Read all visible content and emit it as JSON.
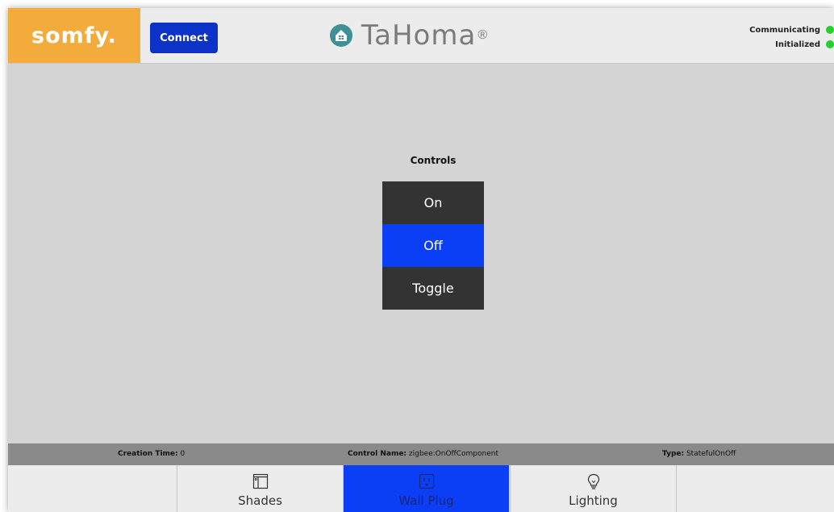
{
  "header": {
    "logo_text": "somfy.",
    "connect_label": "Connect",
    "brand_name": "TaHoma",
    "brand_mark": "®",
    "status": [
      {
        "label": "Communicating",
        "color": "#22d12b"
      },
      {
        "label": "Initialized",
        "color": "#22d12b"
      }
    ]
  },
  "controls": {
    "title": "Controls",
    "buttons": [
      {
        "label": "On",
        "active": false
      },
      {
        "label": "Off",
        "active": true
      },
      {
        "label": "Toggle",
        "active": false
      }
    ]
  },
  "info_bar": {
    "creation_label": "Creation Time:",
    "creation_value": "0",
    "control_label": "Control Name:",
    "control_value": "zigbee:OnOffComponent",
    "type_label": "Type:",
    "type_value": "StatefulOnOff"
  },
  "nav": {
    "tabs": [
      {
        "label": "Shades",
        "icon": "shades-icon",
        "active": false
      },
      {
        "label": "Wall Plug",
        "icon": "wall-plug-icon",
        "active": true
      },
      {
        "label": "Lighting",
        "icon": "lightbulb-icon",
        "active": false
      }
    ]
  },
  "colors": {
    "accent_blue": "#0a3ff5",
    "logo_orange": "#f3ab3b",
    "button_dark": "#333333",
    "status_green": "#22d12b"
  }
}
